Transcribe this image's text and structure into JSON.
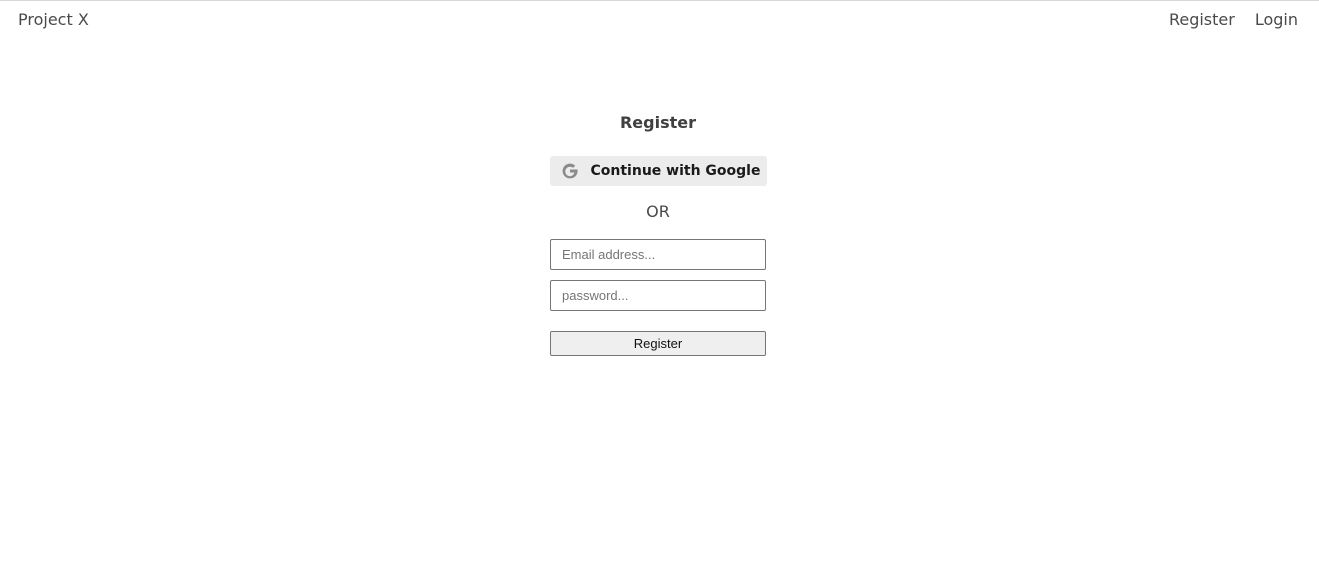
{
  "navbar": {
    "brand": "Project X",
    "links": [
      {
        "label": "Register"
      },
      {
        "label": "Login"
      }
    ]
  },
  "auth": {
    "title": "Register",
    "google_button_label": "Continue with Google",
    "google_icon": "google-g-icon",
    "divider": "OR",
    "email": {
      "value": "",
      "placeholder": "Email address..."
    },
    "password": {
      "value": "",
      "placeholder": "password..."
    },
    "submit_label": "Register"
  }
}
